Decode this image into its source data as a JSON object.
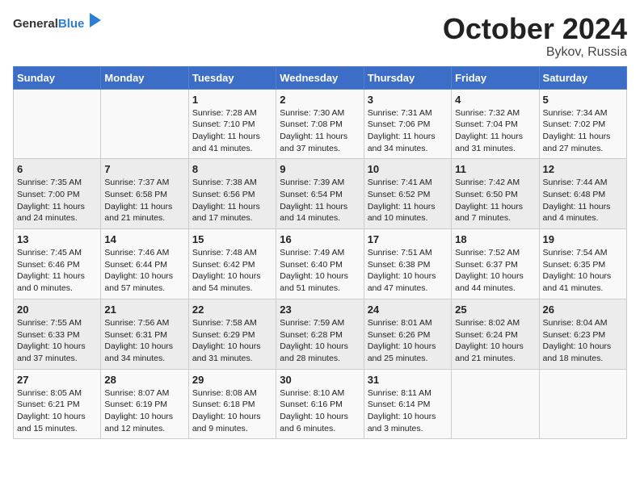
{
  "header": {
    "logo_general": "General",
    "logo_blue": "Blue",
    "title": "October 2024",
    "subtitle": "Bykov, Russia"
  },
  "columns": [
    "Sunday",
    "Monday",
    "Tuesday",
    "Wednesday",
    "Thursday",
    "Friday",
    "Saturday"
  ],
  "weeks": [
    [
      {
        "day": "",
        "info": ""
      },
      {
        "day": "",
        "info": ""
      },
      {
        "day": "1",
        "info": "Sunrise: 7:28 AM\nSunset: 7:10 PM\nDaylight: 11 hours and 41 minutes."
      },
      {
        "day": "2",
        "info": "Sunrise: 7:30 AM\nSunset: 7:08 PM\nDaylight: 11 hours and 37 minutes."
      },
      {
        "day": "3",
        "info": "Sunrise: 7:31 AM\nSunset: 7:06 PM\nDaylight: 11 hours and 34 minutes."
      },
      {
        "day": "4",
        "info": "Sunrise: 7:32 AM\nSunset: 7:04 PM\nDaylight: 11 hours and 31 minutes."
      },
      {
        "day": "5",
        "info": "Sunrise: 7:34 AM\nSunset: 7:02 PM\nDaylight: 11 hours and 27 minutes."
      }
    ],
    [
      {
        "day": "6",
        "info": "Sunrise: 7:35 AM\nSunset: 7:00 PM\nDaylight: 11 hours and 24 minutes."
      },
      {
        "day": "7",
        "info": "Sunrise: 7:37 AM\nSunset: 6:58 PM\nDaylight: 11 hours and 21 minutes."
      },
      {
        "day": "8",
        "info": "Sunrise: 7:38 AM\nSunset: 6:56 PM\nDaylight: 11 hours and 17 minutes."
      },
      {
        "day": "9",
        "info": "Sunrise: 7:39 AM\nSunset: 6:54 PM\nDaylight: 11 hours and 14 minutes."
      },
      {
        "day": "10",
        "info": "Sunrise: 7:41 AM\nSunset: 6:52 PM\nDaylight: 11 hours and 10 minutes."
      },
      {
        "day": "11",
        "info": "Sunrise: 7:42 AM\nSunset: 6:50 PM\nDaylight: 11 hours and 7 minutes."
      },
      {
        "day": "12",
        "info": "Sunrise: 7:44 AM\nSunset: 6:48 PM\nDaylight: 11 hours and 4 minutes."
      }
    ],
    [
      {
        "day": "13",
        "info": "Sunrise: 7:45 AM\nSunset: 6:46 PM\nDaylight: 11 hours and 0 minutes."
      },
      {
        "day": "14",
        "info": "Sunrise: 7:46 AM\nSunset: 6:44 PM\nDaylight: 10 hours and 57 minutes."
      },
      {
        "day": "15",
        "info": "Sunrise: 7:48 AM\nSunset: 6:42 PM\nDaylight: 10 hours and 54 minutes."
      },
      {
        "day": "16",
        "info": "Sunrise: 7:49 AM\nSunset: 6:40 PM\nDaylight: 10 hours and 51 minutes."
      },
      {
        "day": "17",
        "info": "Sunrise: 7:51 AM\nSunset: 6:38 PM\nDaylight: 10 hours and 47 minutes."
      },
      {
        "day": "18",
        "info": "Sunrise: 7:52 AM\nSunset: 6:37 PM\nDaylight: 10 hours and 44 minutes."
      },
      {
        "day": "19",
        "info": "Sunrise: 7:54 AM\nSunset: 6:35 PM\nDaylight: 10 hours and 41 minutes."
      }
    ],
    [
      {
        "day": "20",
        "info": "Sunrise: 7:55 AM\nSunset: 6:33 PM\nDaylight: 10 hours and 37 minutes."
      },
      {
        "day": "21",
        "info": "Sunrise: 7:56 AM\nSunset: 6:31 PM\nDaylight: 10 hours and 34 minutes."
      },
      {
        "day": "22",
        "info": "Sunrise: 7:58 AM\nSunset: 6:29 PM\nDaylight: 10 hours and 31 minutes."
      },
      {
        "day": "23",
        "info": "Sunrise: 7:59 AM\nSunset: 6:28 PM\nDaylight: 10 hours and 28 minutes."
      },
      {
        "day": "24",
        "info": "Sunrise: 8:01 AM\nSunset: 6:26 PM\nDaylight: 10 hours and 25 minutes."
      },
      {
        "day": "25",
        "info": "Sunrise: 8:02 AM\nSunset: 6:24 PM\nDaylight: 10 hours and 21 minutes."
      },
      {
        "day": "26",
        "info": "Sunrise: 8:04 AM\nSunset: 6:23 PM\nDaylight: 10 hours and 18 minutes."
      }
    ],
    [
      {
        "day": "27",
        "info": "Sunrise: 8:05 AM\nSunset: 6:21 PM\nDaylight: 10 hours and 15 minutes."
      },
      {
        "day": "28",
        "info": "Sunrise: 8:07 AM\nSunset: 6:19 PM\nDaylight: 10 hours and 12 minutes."
      },
      {
        "day": "29",
        "info": "Sunrise: 8:08 AM\nSunset: 6:18 PM\nDaylight: 10 hours and 9 minutes."
      },
      {
        "day": "30",
        "info": "Sunrise: 8:10 AM\nSunset: 6:16 PM\nDaylight: 10 hours and 6 minutes."
      },
      {
        "day": "31",
        "info": "Sunrise: 8:11 AM\nSunset: 6:14 PM\nDaylight: 10 hours and 3 minutes."
      },
      {
        "day": "",
        "info": ""
      },
      {
        "day": "",
        "info": ""
      }
    ]
  ]
}
